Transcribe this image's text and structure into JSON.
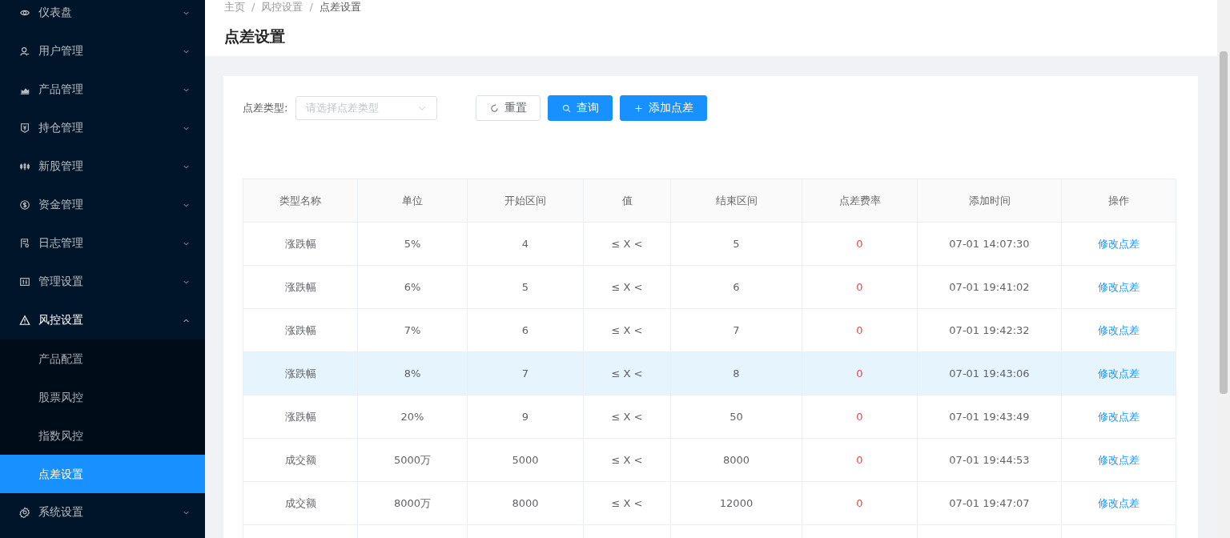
{
  "sidebar": {
    "items": [
      {
        "label": "仪表盘",
        "expanded": false
      },
      {
        "label": "用户管理",
        "expanded": false
      },
      {
        "label": "产品管理",
        "expanded": false
      },
      {
        "label": "持仓管理",
        "expanded": false
      },
      {
        "label": "新股管理",
        "expanded": false
      },
      {
        "label": "资金管理",
        "expanded": false
      },
      {
        "label": "日志管理",
        "expanded": false
      },
      {
        "label": "管理设置",
        "expanded": false
      },
      {
        "label": "风控设置",
        "expanded": true,
        "children": [
          {
            "label": "产品配置",
            "selected": false
          },
          {
            "label": "股票风控",
            "selected": false
          },
          {
            "label": "指数风控",
            "selected": false
          },
          {
            "label": "点差设置",
            "selected": true
          }
        ]
      },
      {
        "label": "系统设置",
        "expanded": false
      }
    ]
  },
  "breadcrumb": {
    "separator": "/",
    "items": [
      "主页",
      "风控设置",
      "点差设置"
    ]
  },
  "page_title": "点差设置",
  "filter": {
    "label": "点差类型:",
    "placeholder": "请选择点差类型"
  },
  "buttons": [
    {
      "kind": "reset",
      "label": "重置"
    },
    {
      "kind": "search",
      "label": "查询"
    },
    {
      "kind": "add",
      "label": "添加点差"
    }
  ],
  "table": {
    "columns": [
      "类型名称",
      "单位",
      "开始区间",
      "值",
      "结束区间",
      "点差费率",
      "添加时间",
      "操作"
    ],
    "rows": [
      {
        "highlighted": false,
        "cells": [
          "涨跌幅",
          "5%",
          "4",
          "≤ X <",
          "5",
          "0",
          "07-01 14:07:30",
          "修改点差"
        ]
      },
      {
        "highlighted": false,
        "cells": [
          "涨跌幅",
          "6%",
          "5",
          "≤ X <",
          "6",
          "0",
          "07-01 19:41:02",
          "修改点差"
        ]
      },
      {
        "highlighted": false,
        "cells": [
          "涨跌幅",
          "7%",
          "6",
          "≤ X <",
          "7",
          "0",
          "07-01 19:42:32",
          "修改点差"
        ]
      },
      {
        "highlighted": true,
        "cells": [
          "涨跌幅",
          "8%",
          "7",
          "≤ X <",
          "8",
          "0",
          "07-01 19:43:06",
          "修改点差"
        ]
      },
      {
        "highlighted": false,
        "cells": [
          "涨跌幅",
          "20%",
          "9",
          "≤ X <",
          "50",
          "0",
          "07-01 19:43:49",
          "修改点差"
        ]
      },
      {
        "highlighted": false,
        "cells": [
          "成交额",
          "5000万",
          "5000",
          "≤ X <",
          "8000",
          "0",
          "07-01 19:44:53",
          "修改点差"
        ]
      },
      {
        "highlighted": false,
        "cells": [
          "成交额",
          "8000万",
          "8000",
          "≤ X <",
          "12000",
          "0",
          "07-01 19:47:07",
          "修改点差"
        ]
      }
    ]
  }
}
